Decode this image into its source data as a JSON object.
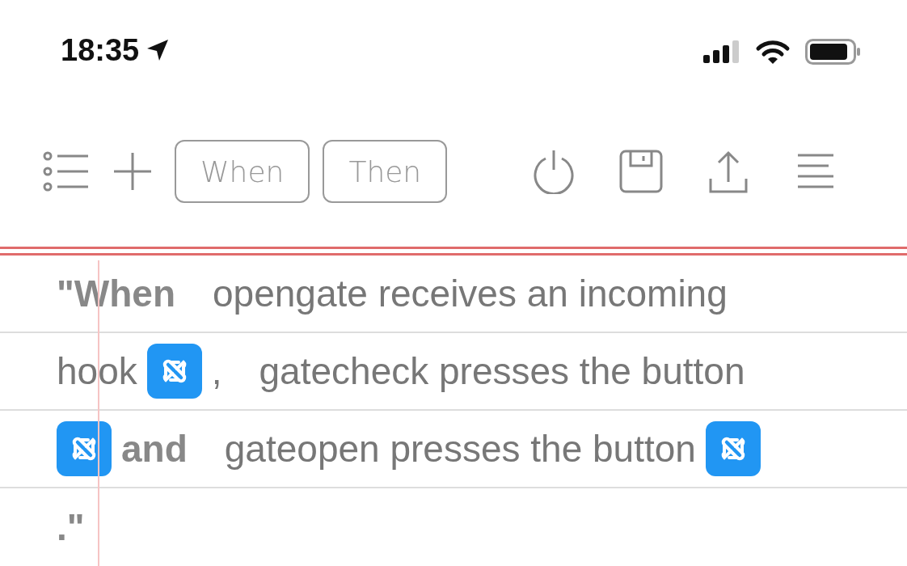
{
  "status_bar": {
    "time": "18:35"
  },
  "toolbar": {
    "buttons": [
      {
        "kind": "list"
      },
      {
        "kind": "add"
      },
      {
        "kind": "chip",
        "label": "When"
      },
      {
        "kind": "chip",
        "label": "Then"
      },
      {
        "kind": "power"
      },
      {
        "kind": "save"
      },
      {
        "kind": "share"
      },
      {
        "kind": "menu"
      }
    ]
  },
  "lines": [
    [
      {
        "kind": "keyword",
        "text": "\"When"
      },
      {
        "kind": "text",
        "text": "opengate receives an incoming"
      }
    ],
    [
      {
        "kind": "text",
        "text": "hook"
      },
      {
        "kind": "service"
      },
      {
        "kind": "text",
        "text": ","
      },
      {
        "kind": "text",
        "text": "gatecheck presses the button"
      }
    ],
    [
      {
        "kind": "service"
      },
      {
        "kind": "keyword",
        "text": "and"
      },
      {
        "kind": "text",
        "text": "gateopen presses the button"
      },
      {
        "kind": "service"
      }
    ],
    [
      {
        "kind": "keyword",
        "text": ".\""
      }
    ]
  ]
}
